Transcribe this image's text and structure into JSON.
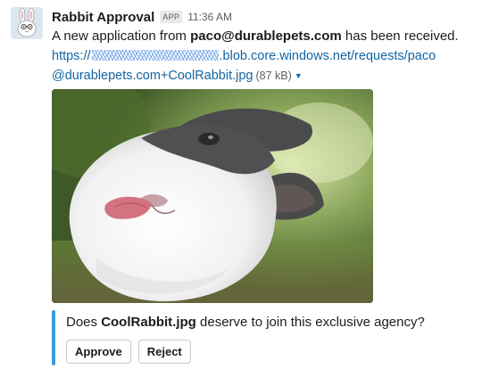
{
  "message": {
    "sender": "Rabbit Approval",
    "badge": "APP",
    "time": "11:36 AM",
    "text_prefix": "A new application from ",
    "text_email": "paco@durablepets.com",
    "text_suffix": " has been received.",
    "link_line1_prefix": "https://",
    "link_line1_suffix": ".blob.core.windows.net/requests/paco",
    "link_line2": "@durablepets.com+CoolRabbit.jpg",
    "file_size": "(87 kB)",
    "avatar_icon": "rabbit-avatar-icon",
    "image_description_icon": "rabbit-photo"
  },
  "attachment": {
    "question_prefix": "Does ",
    "question_file": "CoolRabbit.jpg",
    "question_suffix": " deserve to join this exclusive agency?",
    "accent_color": "#3a9be0",
    "buttons": {
      "approve": "Approve",
      "reject": "Reject"
    }
  },
  "colors": {
    "link": "#1264a3",
    "text": "#1d1c1d",
    "muted": "#616061"
  }
}
